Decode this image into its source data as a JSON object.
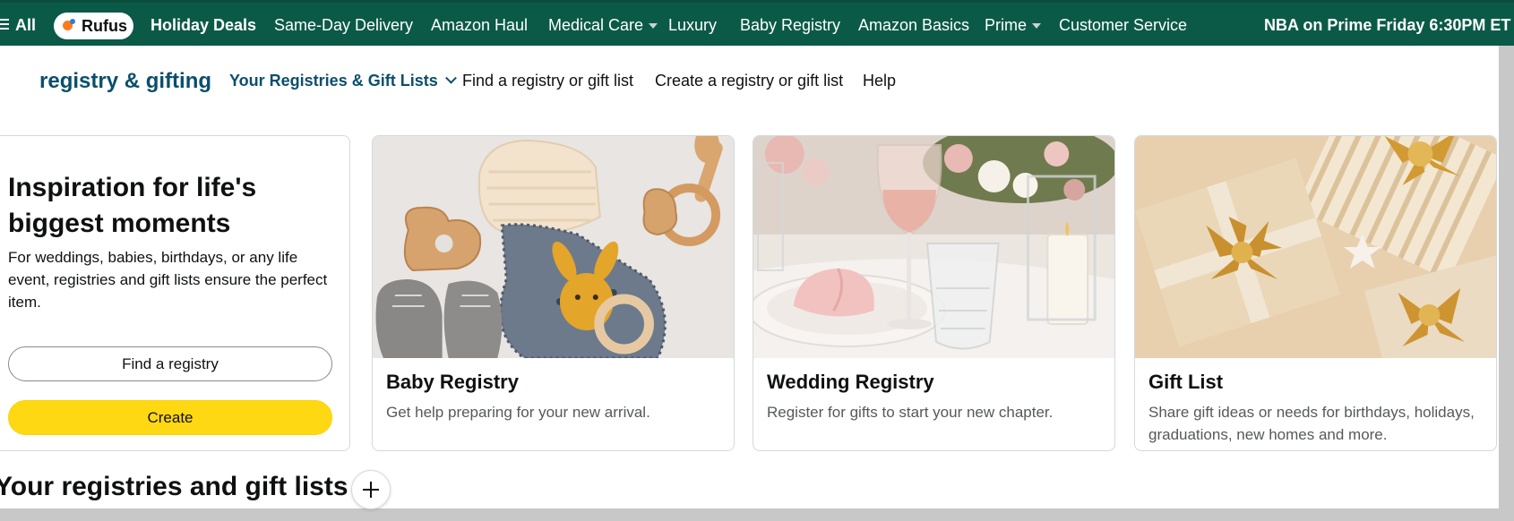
{
  "topnav": {
    "all_label": "All",
    "rufus_label": "Rufus",
    "items": [
      {
        "label": "Holiday Deals"
      },
      {
        "label": "Same-Day Delivery"
      },
      {
        "label": "Amazon Haul"
      },
      {
        "label": "Medical Care"
      },
      {
        "label": "Luxury"
      },
      {
        "label": "Baby Registry"
      },
      {
        "label": "Amazon Basics"
      },
      {
        "label": "Prime"
      },
      {
        "label": "Customer Service"
      }
    ],
    "promo": "NBA on Prime Friday 6:30PM ET"
  },
  "subnav": {
    "brand": "registry & gifting",
    "links": [
      {
        "label": "Your Registries & Gift Lists"
      },
      {
        "label": "Find a registry or gift list"
      },
      {
        "label": "Create a registry or gift list"
      },
      {
        "label": "Help"
      }
    ]
  },
  "intro": {
    "title": "Inspiration for life's biggest moments",
    "body": "For weddings, babies, birthdays, or any life event, registries and gift lists ensure the perfect item.",
    "find_label": "Find a registry",
    "create_label": "Create"
  },
  "cards": [
    {
      "title": "Baby Registry",
      "desc": "Get help preparing for your new arrival."
    },
    {
      "title": "Wedding Registry",
      "desc": "Register for gifts to start your new chapter."
    },
    {
      "title": "Gift List",
      "desc": "Share gift ideas or needs for birthdays, holidays, graduations, new homes and more."
    }
  ],
  "section": {
    "title": "Your registries and gift lists"
  },
  "colors": {
    "nav_bg": "#0b5a48",
    "brand_blue": "#0b4f6c",
    "create_yellow": "#ffd814"
  }
}
